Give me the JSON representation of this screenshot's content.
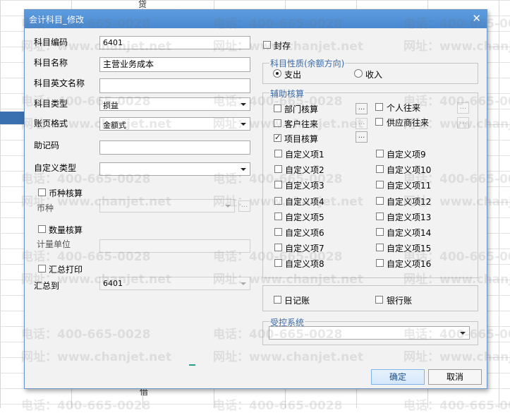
{
  "background": {
    "top_char": "贷",
    "bottom_char": "借",
    "watermark_phone": "电话：400-665-0028",
    "watermark_web": "网址：www.chanjet.net"
  },
  "dialog": {
    "title": "会计科目_修改",
    "close_glyph": "✕",
    "left": {
      "code_label": "科目编码",
      "code_value": "6401",
      "name_label": "科目名称",
      "name_value": "主营业务成本",
      "en_name_label": "科目英文名称",
      "en_name_value": "",
      "type_label": "科目类型",
      "type_value": "损益",
      "book_format_label": "账页格式",
      "book_format_value": "金额式",
      "mnemonic_label": "助记码",
      "mnemonic_value": "",
      "custom_type_label": "自定义类型",
      "custom_type_value": "",
      "currency_check_label": "币种核算",
      "currency_label": "币种",
      "currency_value": "",
      "quantity_check_label": "数量核算",
      "unit_label": "计量单位",
      "unit_value": "",
      "summary_print_label": "汇总打印",
      "summary_to_label": "汇总到",
      "summary_to_value": "6401"
    },
    "right": {
      "sealed_label": "封存",
      "nature_group_title": "科目性质(余额方向)",
      "debit_label": "支出",
      "credit_label": "收入",
      "aux_group_title": "辅助核算",
      "aux_items": {
        "dept": "部门核算",
        "personal": "个人往来",
        "customer": "客户往来",
        "supplier": "供应商往来",
        "project": "项目核算"
      },
      "custom_items": [
        "自定义项1",
        "自定义项2",
        "自定义项3",
        "自定义项4",
        "自定义项5",
        "自定义项6",
        "自定义项7",
        "自定义项8"
      ],
      "custom_items_right": [
        "自定义项9",
        "自定义项10",
        "自定义项11",
        "自定义项12",
        "自定义项13",
        "自定义项14",
        "自定义项15",
        "自定义项16"
      ],
      "journal_label": "日记账",
      "bank_journal_label": "银行账",
      "controlled_group_title": "受控系统",
      "controlled_value": ""
    },
    "ellipsis_glyph": "...",
    "ok_label": "确定",
    "cancel_label": "取消"
  }
}
